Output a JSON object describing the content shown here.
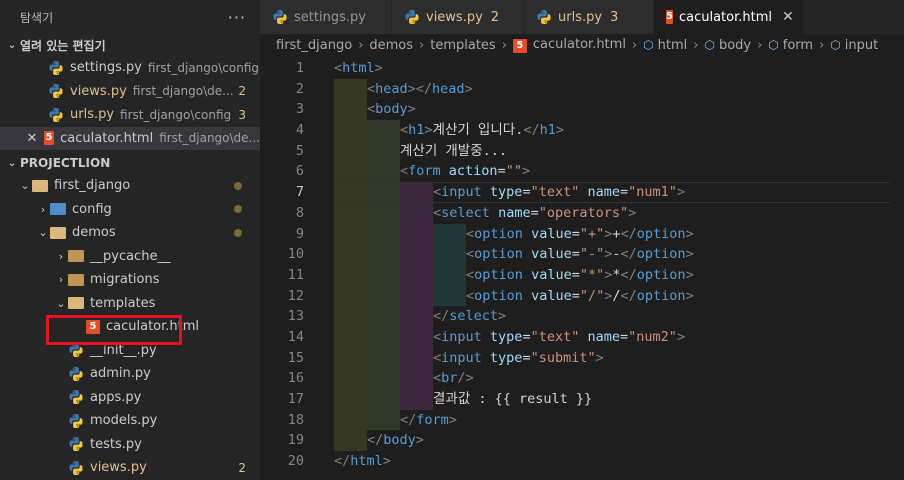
{
  "explorer": {
    "title": "탐색기",
    "more": "···",
    "open_editors_title": "열려 있는 편집기",
    "open_editors": [
      {
        "name": "settings.py",
        "path": "first_django\\config",
        "badge": "",
        "yellow": false,
        "icon": "python-icon"
      },
      {
        "name": "views.py",
        "path": "first_django\\de...",
        "badge": "2",
        "yellow": true,
        "icon": "python-icon"
      },
      {
        "name": "urls.py",
        "path": "first_django\\config",
        "badge": "3",
        "yellow": true,
        "icon": "python-icon"
      },
      {
        "name": "caculator.html",
        "path": "first_django\\de...",
        "badge": "",
        "yellow": false,
        "icon": "html5-icon",
        "active": true,
        "close": "✕"
      }
    ],
    "project_title": "PROJECTLION",
    "tree": [
      {
        "label": "first_django",
        "depth": 1,
        "type": "folder-open",
        "chev": "⌄",
        "dot": true
      },
      {
        "label": "config",
        "depth": 2,
        "type": "folder-blue",
        "chev": "›",
        "dot": true
      },
      {
        "label": "demos",
        "depth": 2,
        "type": "folder-open",
        "chev": "⌄",
        "dot": true
      },
      {
        "label": "__pycache__",
        "depth": 3,
        "type": "folder",
        "chev": "›"
      },
      {
        "label": "migrations",
        "depth": 3,
        "type": "folder",
        "chev": "›"
      },
      {
        "label": "templates",
        "depth": 3,
        "type": "folder-open",
        "chev": "⌄"
      },
      {
        "label": "caculator.html",
        "depth": 4,
        "type": "html"
      },
      {
        "label": "__init__.py",
        "depth": 3,
        "type": "python"
      },
      {
        "label": "admin.py",
        "depth": 3,
        "type": "python"
      },
      {
        "label": "apps.py",
        "depth": 3,
        "type": "python"
      },
      {
        "label": "models.py",
        "depth": 3,
        "type": "python"
      },
      {
        "label": "tests.py",
        "depth": 3,
        "type": "python"
      },
      {
        "label": "views.py",
        "depth": 3,
        "type": "python",
        "badge": "2",
        "yellow": true
      }
    ]
  },
  "tabs": [
    {
      "label": "settings.py",
      "icon": "python-icon",
      "badge": "",
      "yellow": false
    },
    {
      "label": "views.py",
      "icon": "python-icon",
      "badge": "2",
      "yellow": true
    },
    {
      "label": "urls.py",
      "icon": "python-icon",
      "badge": "3",
      "yellow": true
    },
    {
      "label": "caculator.html",
      "icon": "html5-icon",
      "badge": "",
      "active": true,
      "close": "✕"
    }
  ],
  "breadcrumb": [
    "first_django",
    "demos",
    "templates",
    "caculator.html",
    "html",
    "body",
    "form",
    "input"
  ],
  "breadcrumb_sep": "›",
  "editor": {
    "current_line": 7,
    "lines": [
      [
        [
          "<",
          "p"
        ],
        [
          "html",
          "tag"
        ],
        [
          ">",
          "p"
        ]
      ],
      [
        [
          "<",
          "p"
        ],
        [
          "head",
          "tag"
        ],
        [
          "></",
          "p"
        ],
        [
          "head",
          "tag"
        ],
        [
          ">",
          "p"
        ]
      ],
      [
        [
          "<",
          "p"
        ],
        [
          "body",
          "tag"
        ],
        [
          ">",
          "p"
        ]
      ],
      [
        [
          "<",
          "p"
        ],
        [
          "h1",
          "tag"
        ],
        [
          ">",
          "p"
        ],
        [
          "계산기 입니다.",
          "txt"
        ],
        [
          "</",
          "p"
        ],
        [
          "h1",
          "tag"
        ],
        [
          ">",
          "p"
        ]
      ],
      [
        [
          "계산기 개발중...",
          "txt"
        ]
      ],
      [
        [
          "<",
          "p"
        ],
        [
          "form",
          "tag"
        ],
        [
          " ",
          "txt"
        ],
        [
          "action",
          "attr"
        ],
        [
          "=",
          "txt"
        ],
        [
          "\"\"",
          "str"
        ],
        [
          ">",
          "p"
        ]
      ],
      [
        [
          "<",
          "p"
        ],
        [
          "input",
          "tag"
        ],
        [
          " ",
          "txt"
        ],
        [
          "type",
          "attr"
        ],
        [
          "=",
          "txt"
        ],
        [
          "\"text\"",
          "str"
        ],
        [
          " ",
          "txt"
        ],
        [
          "name",
          "attr"
        ],
        [
          "=",
          "txt"
        ],
        [
          "\"num1\"",
          "str"
        ],
        [
          ">",
          "p"
        ]
      ],
      [
        [
          "<",
          "p"
        ],
        [
          "select",
          "tag"
        ],
        [
          " ",
          "txt"
        ],
        [
          "name",
          "attr"
        ],
        [
          "=",
          "txt"
        ],
        [
          "\"operators\"",
          "str"
        ],
        [
          ">",
          "p"
        ]
      ],
      [
        [
          "<",
          "p"
        ],
        [
          "option",
          "tag"
        ],
        [
          " ",
          "txt"
        ],
        [
          "value",
          "attr"
        ],
        [
          "=",
          "txt"
        ],
        [
          "\"+\"",
          "str"
        ],
        [
          ">",
          "p"
        ],
        [
          "+",
          "txt"
        ],
        [
          "</",
          "p"
        ],
        [
          "option",
          "tag"
        ],
        [
          ">",
          "p"
        ]
      ],
      [
        [
          "<",
          "p"
        ],
        [
          "option",
          "tag"
        ],
        [
          " ",
          "txt"
        ],
        [
          "value",
          "attr"
        ],
        [
          "=",
          "txt"
        ],
        [
          "\"-\"",
          "str"
        ],
        [
          ">",
          "p"
        ],
        [
          "-",
          "txt"
        ],
        [
          "</",
          "p"
        ],
        [
          "option",
          "tag"
        ],
        [
          ">",
          "p"
        ]
      ],
      [
        [
          "<",
          "p"
        ],
        [
          "option",
          "tag"
        ],
        [
          " ",
          "txt"
        ],
        [
          "value",
          "attr"
        ],
        [
          "=",
          "txt"
        ],
        [
          "\"*\"",
          "str"
        ],
        [
          ">",
          "p"
        ],
        [
          "*",
          "txt"
        ],
        [
          "</",
          "p"
        ],
        [
          "option",
          "tag"
        ],
        [
          ">",
          "p"
        ]
      ],
      [
        [
          "<",
          "p"
        ],
        [
          "option",
          "tag"
        ],
        [
          " ",
          "txt"
        ],
        [
          "value",
          "attr"
        ],
        [
          "=",
          "txt"
        ],
        [
          "\"/\"",
          "str"
        ],
        [
          ">",
          "p"
        ],
        [
          "/",
          "txt"
        ],
        [
          "</",
          "p"
        ],
        [
          "option",
          "tag"
        ],
        [
          ">",
          "p"
        ]
      ],
      [
        [
          "</",
          "p"
        ],
        [
          "select",
          "tag"
        ],
        [
          ">",
          "p"
        ]
      ],
      [
        [
          "<",
          "p"
        ],
        [
          "input",
          "tag"
        ],
        [
          " ",
          "txt"
        ],
        [
          "type",
          "attr"
        ],
        [
          "=",
          "txt"
        ],
        [
          "\"text\"",
          "str"
        ],
        [
          " ",
          "txt"
        ],
        [
          "name",
          "attr"
        ],
        [
          "=",
          "txt"
        ],
        [
          "\"num2\"",
          "str"
        ],
        [
          ">",
          "p"
        ]
      ],
      [
        [
          "<",
          "p"
        ],
        [
          "input",
          "tag"
        ],
        [
          " ",
          "txt"
        ],
        [
          "type",
          "attr"
        ],
        [
          "=",
          "txt"
        ],
        [
          "\"submit\"",
          "str"
        ],
        [
          ">",
          "p"
        ]
      ],
      [
        [
          "<",
          "p"
        ],
        [
          "br",
          "tag"
        ],
        [
          "/>",
          "p"
        ]
      ],
      [
        [
          "결과값 : {{ result }}",
          "txt"
        ]
      ],
      [
        [
          "</",
          "p"
        ],
        [
          "form",
          "tag"
        ],
        [
          ">",
          "p"
        ]
      ],
      [
        [
          "</",
          "p"
        ],
        [
          "body",
          "tag"
        ],
        [
          ">",
          "p"
        ]
      ],
      [
        [
          "</",
          "p"
        ],
        [
          "html",
          "tag"
        ],
        [
          ">",
          "p"
        ]
      ]
    ],
    "indents": [
      0,
      1,
      1,
      2,
      2,
      2,
      3,
      3,
      4,
      4,
      4,
      4,
      3,
      3,
      3,
      3,
      3,
      2,
      1,
      0
    ]
  }
}
